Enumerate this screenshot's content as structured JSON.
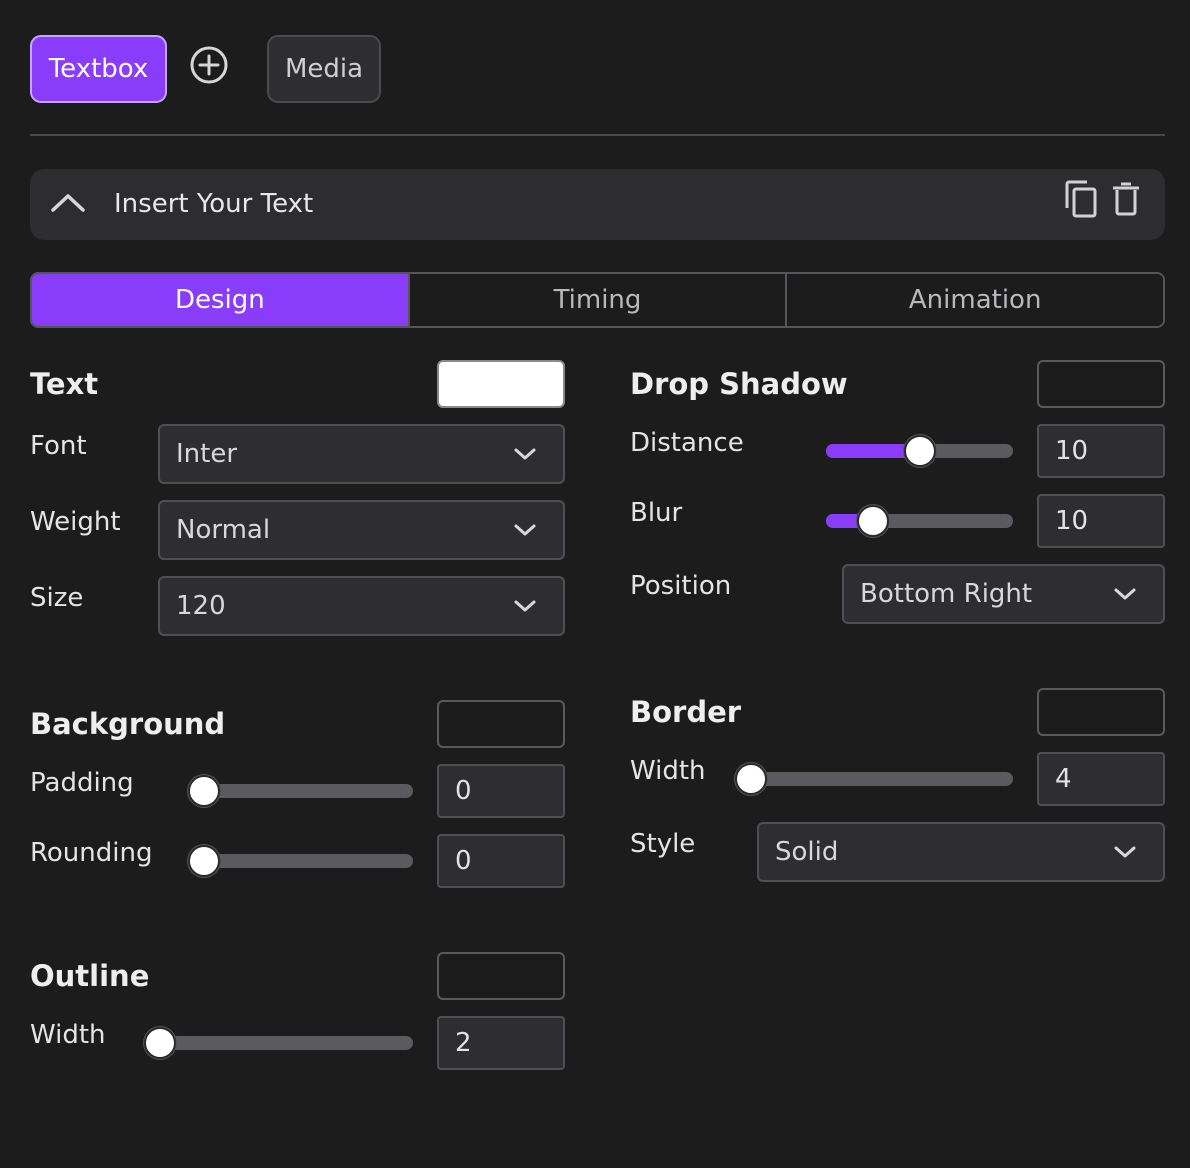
{
  "top_tabs": {
    "textbox": "Textbox",
    "media": "Media"
  },
  "text_item": {
    "title": "Insert Your Text"
  },
  "segmented_tabs": [
    "Design",
    "Timing",
    "Animation"
  ],
  "active_tab": "Design",
  "text_section": {
    "title": "Text",
    "color": "#ffffff",
    "font_label": "Font",
    "font_value": "Inter",
    "weight_label": "Weight",
    "weight_value": "Normal",
    "size_label": "Size",
    "size_value": "120"
  },
  "background_section": {
    "title": "Background",
    "padding_label": "Padding",
    "padding_value": "0",
    "padding_level": 0,
    "rounding_label": "Rounding",
    "rounding_value": "0",
    "rounding_level": 0
  },
  "outline_section": {
    "title": "Outline",
    "width_label": "Width",
    "width_value": "2",
    "width_level": 0
  },
  "drop_shadow_section": {
    "title": "Drop Shadow",
    "distance_label": "Distance",
    "distance_value": "10",
    "distance_level": 0.5,
    "blur_label": "Blur",
    "blur_value": "10",
    "blur_level": 0.2,
    "position_label": "Position",
    "position_value": "Bottom Right"
  },
  "border_section": {
    "title": "Border",
    "width_label": "Width",
    "width_value": "4",
    "width_level": 0,
    "style_label": "Style",
    "style_value": "Solid"
  },
  "colors": {
    "accent": "#8a3cfb",
    "background": "#1c1c1d",
    "panel": "#2d2d2f"
  }
}
